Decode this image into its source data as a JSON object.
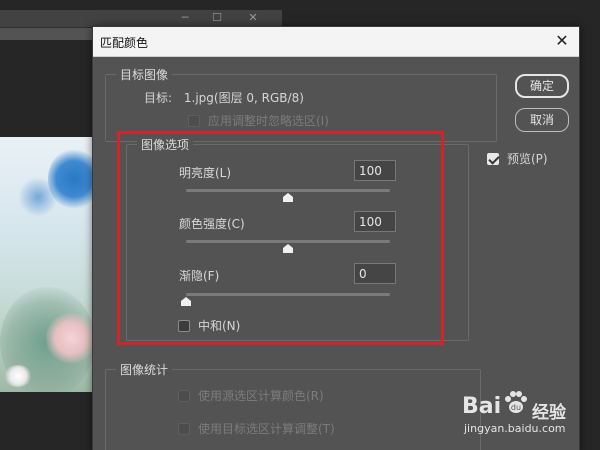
{
  "background": {
    "window_controls": [
      "─",
      "☐",
      "✕"
    ]
  },
  "dialog": {
    "title": "匹配颜色",
    "close_symbol": "✕",
    "target_group": {
      "legend": "目标图像",
      "target_label": "目标:",
      "target_value": "1.jpg(图层 0, RGB/8)",
      "ignore_selection_label": "应用调整时忽略选区(I)",
      "ignore_selection_checked": false,
      "ignore_selection_enabled": false
    },
    "image_options": {
      "legend": "图像选项",
      "luminance": {
        "label": "明亮度(L)",
        "value": "100",
        "slider_fraction": 0.5
      },
      "color_intensity": {
        "label": "颜色强度(C)",
        "value": "100",
        "slider_fraction": 0.5
      },
      "fade": {
        "label": "渐隐(F)",
        "value": "0",
        "slider_fraction": 0.0
      },
      "neutralize": {
        "label": "中和(N)",
        "checked": false
      }
    },
    "image_statistics": {
      "legend": "图像统计",
      "use_source_selection_label": "使用源选区计算颜色(R)",
      "use_target_selection_label": "使用目标选区计算调整(T)"
    },
    "buttons": {
      "ok_label": "确定",
      "cancel_label": "取消"
    },
    "preview": {
      "label": "预览(P)",
      "checked": true
    }
  },
  "watermark": {
    "brand": "Bai",
    "brand_cn": "经验",
    "url": "jingyan.baidu.com"
  },
  "colors": {
    "dialog_bg": "#535353",
    "highlight": "#d3242c",
    "titlebar_bg": "#f4f4f4"
  }
}
